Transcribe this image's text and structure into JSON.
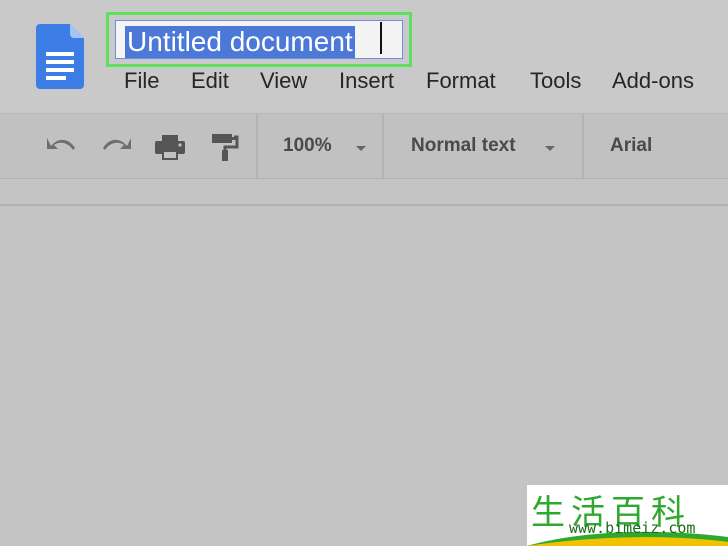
{
  "document": {
    "title": "Untitled document"
  },
  "menu": {
    "items": [
      {
        "label": "File"
      },
      {
        "label": "Edit"
      },
      {
        "label": "View"
      },
      {
        "label": "Insert"
      },
      {
        "label": "Format"
      },
      {
        "label": "Tools"
      },
      {
        "label": "Add-ons"
      }
    ]
  },
  "toolbar": {
    "icons": [
      "undo-icon",
      "redo-icon",
      "print-icon",
      "paint-format-icon"
    ],
    "zoom": "100%",
    "style": "Normal text",
    "font": "Arial"
  },
  "watermark": {
    "chars": "生活百科",
    "url": "www.bimeiz.com"
  },
  "colors": {
    "highlight_border": "#5ee05e",
    "selection": "#4c79d8",
    "docs_blue": "#3d7ee6"
  }
}
